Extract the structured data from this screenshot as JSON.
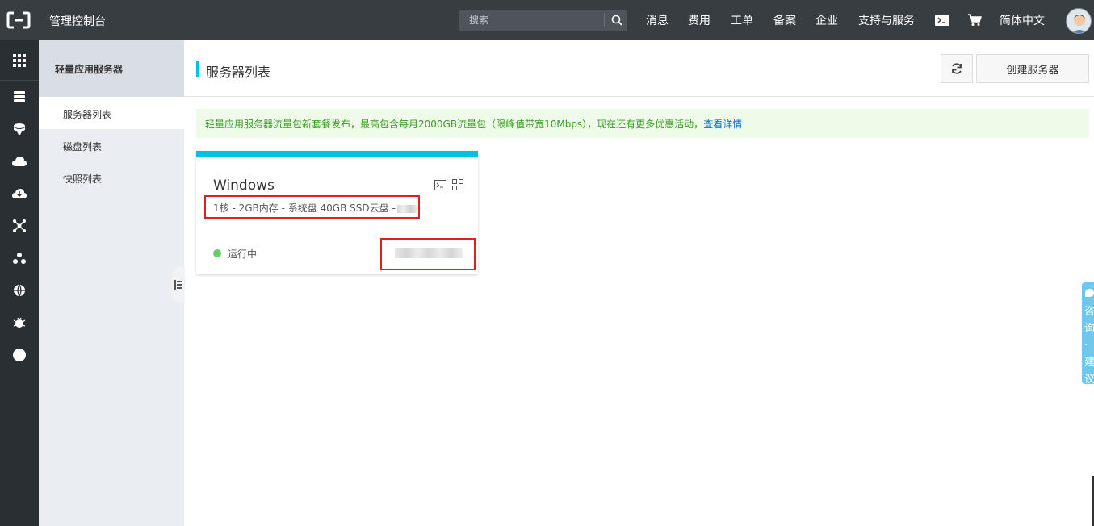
{
  "topbar": {
    "brand": "管理控制台",
    "search_placeholder": "搜索",
    "nav": [
      "消息",
      "费用",
      "工单",
      "备案",
      "企业",
      "支持与服务"
    ],
    "language": "简体中文",
    "icons": [
      "terminal-icon",
      "cart-icon"
    ]
  },
  "rail": {
    "icons": [
      "grid-icon",
      "server-icon",
      "database-icon",
      "cloud-upload-icon",
      "cloud-download-icon",
      "network-icon",
      "cluster-icon",
      "globe-icon",
      "bug-icon",
      "circle-icon"
    ]
  },
  "sidebar": {
    "header": "轻量应用服务器",
    "items": [
      {
        "label": "服务器列表",
        "active": true
      },
      {
        "label": "磁盘列表",
        "active": false
      },
      {
        "label": "快照列表",
        "active": false
      }
    ]
  },
  "main": {
    "title": "服务器列表",
    "create_label": "创建服务器",
    "notice_text": "轻量应用服务器流量包新套餐发布，最高包含每月2000GB流量包（限峰值带宽10Mbps），现在还有更多优惠活动，",
    "notice_link": "查看详情"
  },
  "card": {
    "os": "Windows",
    "spec": "1核 - 2GB内存 - 系统盘 40GB SSD云盘 -",
    "status": "运行中"
  },
  "feedback": {
    "label": "咨询·建议"
  },
  "colors": {
    "topbar": "#373d41",
    "accent": "#00c1de",
    "running": "#6ccc6c",
    "highlight": "#e02020"
  }
}
